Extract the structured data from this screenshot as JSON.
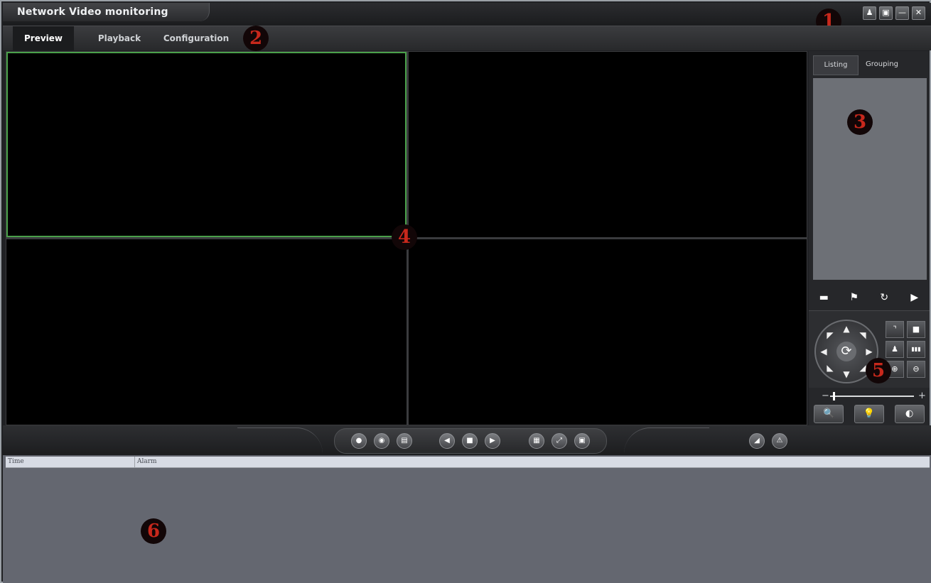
{
  "app": {
    "title": "Network Video monitoring"
  },
  "window_buttons": [
    {
      "name": "user-icon",
      "glyph": "♟"
    },
    {
      "name": "lock-icon",
      "glyph": "▣"
    },
    {
      "name": "minimize-icon",
      "glyph": "—"
    },
    {
      "name": "close-icon",
      "glyph": "✕"
    }
  ],
  "menu": {
    "preview": "Preview",
    "playback": "Playback",
    "configuration": "Configuration",
    "active": "Preview"
  },
  "callouts": {
    "c1": "1",
    "c2": "2",
    "c3": "3",
    "c4": "4",
    "c5": "5",
    "c6": "6"
  },
  "side_panel": {
    "tabs": {
      "listing": "Listing",
      "grouping": "Grouping"
    },
    "active_tab": "Listing",
    "tools": [
      {
        "name": "window-icon",
        "glyph": "▬"
      },
      {
        "name": "flag-icon",
        "glyph": "⚑"
      },
      {
        "name": "refresh-icon",
        "glyph": "↻"
      },
      {
        "name": "tag-icon",
        "glyph": "▶"
      }
    ]
  },
  "ptz": {
    "arrows": {
      "up": "▲",
      "down": "▼",
      "left": "◀",
      "right": "▶",
      "up_left": "◤",
      "up_right": "◥",
      "down_left": "◣",
      "down_right": "◢",
      "center": "⟳"
    },
    "buttons": [
      {
        "name": "corner-icon",
        "glyph": "⌝"
      },
      {
        "name": "square-icon",
        "glyph": "■"
      },
      {
        "name": "person-icon",
        "glyph": "♟"
      },
      {
        "name": "bars-icon",
        "glyph": "▮▮▮"
      },
      {
        "name": "plus-circle-icon",
        "glyph": "⊕"
      },
      {
        "name": "minus-circle-icon",
        "glyph": "⊖"
      }
    ],
    "slider_minus": "−",
    "slider_plus": "+",
    "lens": [
      {
        "name": "zoom-icon",
        "glyph": "🔍"
      },
      {
        "name": "focus-icon",
        "glyph": "💡"
      },
      {
        "name": "iris-icon",
        "glyph": "◐"
      }
    ]
  },
  "controls": [
    {
      "name": "record-icon",
      "glyph": "●"
    },
    {
      "name": "snapshot-icon",
      "glyph": "◉"
    },
    {
      "name": "list-icon",
      "glyph": "▤"
    },
    {
      "name": "prev-icon",
      "glyph": "◀"
    },
    {
      "name": "stop-icon",
      "glyph": "■"
    },
    {
      "name": "next-icon",
      "glyph": "▶"
    },
    {
      "name": "layout-icon",
      "glyph": "▦"
    },
    {
      "name": "fullscreen-icon",
      "glyph": "⤢"
    },
    {
      "name": "split-icon",
      "glyph": "▣"
    },
    {
      "name": "audio-icon",
      "glyph": "◢"
    },
    {
      "name": "warning-icon",
      "glyph": "⚠"
    }
  ],
  "log": {
    "columns": [
      "Time",
      "Alarm"
    ]
  },
  "colors": {
    "selected_pane_border": "#4aa04a",
    "callout_text": "#c8281c"
  }
}
